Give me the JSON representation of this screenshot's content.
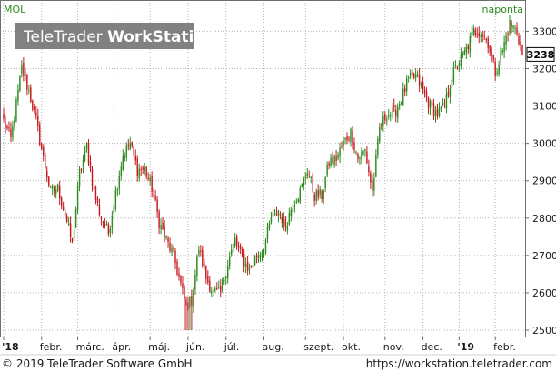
{
  "header": {
    "symbol": "MOL",
    "period": "naponta",
    "logo_light": "TeleTrader ",
    "logo_bold": "WorkStation"
  },
  "footer": {
    "copyright": "© 2019 TeleTrader Software GmbH",
    "url": "https://workstation.teletrader.com"
  },
  "colors": {
    "up": "#2e8b1f",
    "down": "#c8191e",
    "grid": "#b5b5b5",
    "symbol": "#2e8b1f",
    "last_box": "#000000"
  },
  "chart_data": {
    "type": "candlestick",
    "title": "MOL",
    "interval": "naponta",
    "ylim": [
      2480,
      3360
    ],
    "y_ticks": [
      2500,
      2600,
      2700,
      2800,
      2900,
      3000,
      3100,
      3200,
      3300
    ],
    "grid": true,
    "last_value": 3238,
    "x_axis_labels": [
      {
        "label": "'18",
        "bold": true,
        "index": 0
      },
      {
        "label": "febr.",
        "bold": false,
        "index": 21
      },
      {
        "label": "márc.",
        "bold": false,
        "index": 41
      },
      {
        "label": "ápr.",
        "bold": false,
        "index": 61
      },
      {
        "label": "máj.",
        "bold": false,
        "index": 81
      },
      {
        "label": "jún.",
        "bold": false,
        "index": 102
      },
      {
        "label": "júl.",
        "bold": false,
        "index": 123
      },
      {
        "label": "aug.",
        "bold": false,
        "index": 144
      },
      {
        "label": "szept.",
        "bold": false,
        "index": 167
      },
      {
        "label": "okt.",
        "bold": false,
        "index": 188
      },
      {
        "label": "nov.",
        "bold": false,
        "index": 211
      },
      {
        "label": "dec.",
        "bold": false,
        "index": 232
      },
      {
        "label": "'19",
        "bold": true,
        "index": 252
      },
      {
        "label": "febr.",
        "bold": false,
        "index": 272
      }
    ],
    "close_keypoints": [
      [
        0,
        3060
      ],
      [
        4,
        3010
      ],
      [
        10,
        3200
      ],
      [
        14,
        3140
      ],
      [
        18,
        3060
      ],
      [
        22,
        2960
      ],
      [
        26,
        2870
      ],
      [
        30,
        2880
      ],
      [
        34,
        2810
      ],
      [
        38,
        2730
      ],
      [
        42,
        2920
      ],
      [
        46,
        2990
      ],
      [
        50,
        2870
      ],
      [
        54,
        2800
      ],
      [
        58,
        2760
      ],
      [
        62,
        2870
      ],
      [
        66,
        2970
      ],
      [
        70,
        3000
      ],
      [
        74,
        2930
      ],
      [
        78,
        2930
      ],
      [
        82,
        2880
      ],
      [
        86,
        2790
      ],
      [
        90,
        2740
      ],
      [
        94,
        2700
      ],
      [
        98,
        2620
      ],
      [
        101,
        2560
      ],
      [
        104,
        2580
      ],
      [
        108,
        2720
      ],
      [
        112,
        2640
      ],
      [
        116,
        2600
      ],
      [
        120,
        2600
      ],
      [
        124,
        2680
      ],
      [
        128,
        2740
      ],
      [
        132,
        2690
      ],
      [
        136,
        2660
      ],
      [
        140,
        2700
      ],
      [
        144,
        2720
      ],
      [
        148,
        2800
      ],
      [
        152,
        2820
      ],
      [
        156,
        2780
      ],
      [
        160,
        2840
      ],
      [
        164,
        2870
      ],
      [
        168,
        2930
      ],
      [
        172,
        2860
      ],
      [
        176,
        2860
      ],
      [
        180,
        2950
      ],
      [
        184,
        2960
      ],
      [
        188,
        3000
      ],
      [
        192,
        3030
      ],
      [
        196,
        2960
      ],
      [
        200,
        2980
      ],
      [
        204,
        2870
      ],
      [
        208,
        3040
      ],
      [
        212,
        3080
      ],
      [
        216,
        3080
      ],
      [
        220,
        3120
      ],
      [
        224,
        3170
      ],
      [
        228,
        3180
      ],
      [
        232,
        3140
      ],
      [
        236,
        3100
      ],
      [
        240,
        3080
      ],
      [
        244,
        3100
      ],
      [
        248,
        3180
      ],
      [
        252,
        3220
      ],
      [
        256,
        3250
      ],
      [
        260,
        3300
      ],
      [
        264,
        3300
      ],
      [
        268,
        3270
      ],
      [
        272,
        3190
      ],
      [
        276,
        3250
      ],
      [
        280,
        3320
      ],
      [
        284,
        3300
      ],
      [
        287,
        3238
      ]
    ],
    "highlight_extremes": {
      "low": 2500,
      "high": 3340
    }
  }
}
